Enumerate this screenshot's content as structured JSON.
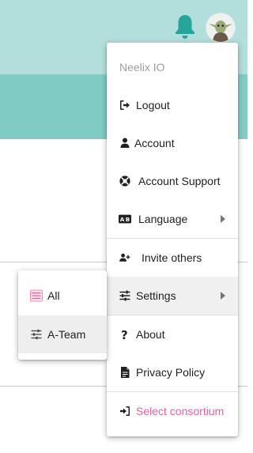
{
  "header": {
    "brand_colors": {
      "top": "#b2dfdb",
      "band": "#80cbc4",
      "bell": "#26a69a"
    },
    "notification_icon": "bell-icon",
    "avatar_icon": "yoda-avatar"
  },
  "user_menu": {
    "user_name": "Neelix IO",
    "items": [
      {
        "label": "Logout",
        "icon": "logout-icon"
      },
      {
        "label": "Account",
        "icon": "person-icon"
      },
      {
        "label": "Account Support",
        "icon": "lifebuoy-icon"
      },
      {
        "label": "Language",
        "icon": "translate-icon",
        "has_submenu": true
      },
      {
        "label": "Invite others",
        "icon": "person-add-icon"
      },
      {
        "label": "Settings",
        "icon": "tune-icon",
        "has_submenu": true,
        "active": true
      },
      {
        "label": "About",
        "icon": "question-icon"
      },
      {
        "label": "Privacy Policy",
        "icon": "document-icon"
      },
      {
        "label": "Select consortium",
        "icon": "login-icon",
        "color": "#ec5fa0"
      }
    ]
  },
  "settings_submenu": {
    "items": [
      {
        "label": "All",
        "icon": "list-pink-icon"
      },
      {
        "label": "A-Team",
        "icon": "tune-icon",
        "active": true
      }
    ]
  }
}
